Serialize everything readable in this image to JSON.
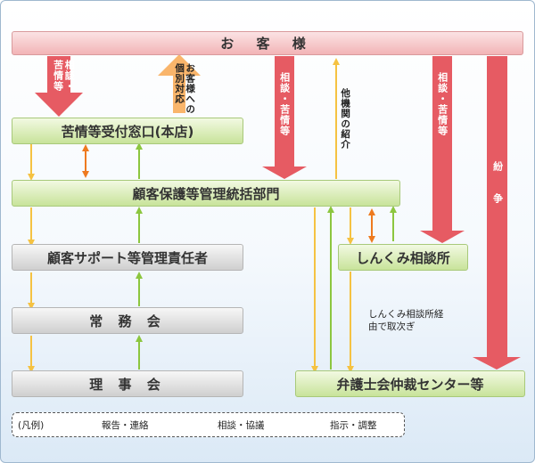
{
  "nodes": {
    "customer": "お 客 様",
    "complaint_window": "苦情等受付窓口(本店)",
    "management_dept": "顧客保護等管理統括部門",
    "support_manager": "顧客サポート等管理責任者",
    "executive_meeting": "常 務 会",
    "board": "理 事 会",
    "shinkumi_center": "しんくみ相談所",
    "adr_center": "弁護士会仲裁センター等"
  },
  "arrow_labels": {
    "consult_complaint_a": "相談・苦情等",
    "individual_response": "お客様への個別対応",
    "consult_complaint_b": "相談・苦情等",
    "other_agency": "他機関の紹介",
    "consult_complaint_c": "相談・苦情等",
    "dispute": "紛 争"
  },
  "note": "しんくみ相談所経由で取次ぎ",
  "legend": {
    "title": "(凡例)",
    "report": "報告・連絡",
    "consult": "相談・協議",
    "instruct": "指示・調整"
  },
  "colors": {
    "report": "#f5c242",
    "consult": "#ee7a1f",
    "instruct": "#8cc63f",
    "big_arrow": "#e65b63",
    "response_arrow": "#f9b56b"
  }
}
